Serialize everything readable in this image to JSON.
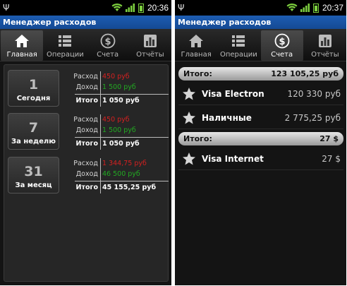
{
  "app_title": "Менеджер расходов",
  "status": {
    "left_time": "20:36",
    "right_time": "20:37"
  },
  "tabs": [
    {
      "label": "Главная",
      "icon": "home-icon"
    },
    {
      "label": "Операции",
      "icon": "list-icon"
    },
    {
      "label": "Счета",
      "icon": "dollar-icon"
    },
    {
      "label": "Отчёты",
      "icon": "bar-chart-icon"
    }
  ],
  "left": {
    "active_tab": "Главная",
    "periods": [
      {
        "label": "Сегодня",
        "cal_num": "1",
        "expense": "450 руб",
        "income": "1 500 руб",
        "total": "1 050 руб"
      },
      {
        "label": "За неделю",
        "cal_num": "7",
        "expense": "450 руб",
        "income": "1 500 руб",
        "total": "1 050 руб"
      },
      {
        "label": "За месяц",
        "cal_num": "31",
        "expense": "1 344,75 руб",
        "income": "46 500 руб",
        "total": "45 155,25 руб"
      }
    ],
    "labels": {
      "expense": "Расход",
      "income": "Доход",
      "total": "Итого"
    }
  },
  "right": {
    "active_tab": "Счета",
    "groups": [
      {
        "total_label": "Итого:",
        "total_value": "123 105,25 руб",
        "accounts": [
          {
            "name": "Visa Electron",
            "amount": "120 330 руб"
          },
          {
            "name": "Наличные",
            "amount": "2 775,25 руб"
          }
        ]
      },
      {
        "total_label": "Итого:",
        "total_value": "27 $",
        "accounts": [
          {
            "name": "Visa Internet",
            "amount": "27 $"
          }
        ]
      }
    ]
  },
  "colors": {
    "title_bar": "#1d5db2",
    "expense": "#d42020",
    "income": "#22aa22",
    "battery": "#7ed13f"
  }
}
